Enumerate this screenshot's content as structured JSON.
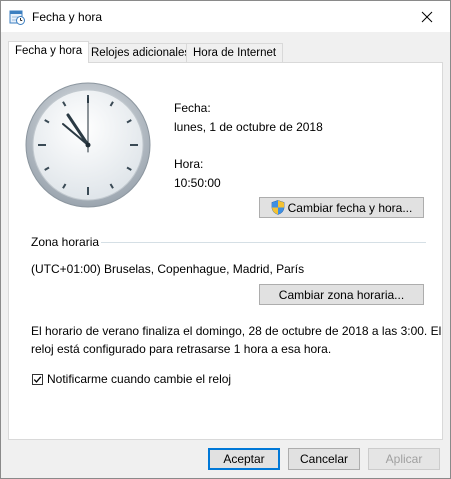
{
  "window": {
    "title": "Fecha y hora",
    "close_glyph": "✕"
  },
  "tabs": [
    {
      "label": "Fecha y hora",
      "active": true
    },
    {
      "label": "Relojes adicionales",
      "active": false
    },
    {
      "label": "Hora de Internet",
      "active": false
    }
  ],
  "datetime": {
    "date_label": "Fecha:",
    "date_value": "lunes, 1 de octubre de 2018",
    "time_label": "Hora:",
    "time_value": "10:50:00",
    "change_button": "Cambiar fecha y hora..."
  },
  "timezone": {
    "group_label": "Zona horaria",
    "value": "(UTC+01:00) Bruselas, Copenhague, Madrid, París",
    "change_button": "Cambiar zona horaria..."
  },
  "dst": {
    "notice_line1": "El horario de verano finaliza el domingo, 28 de octubre de 2018 a las 3:00. El",
    "notice_line2": "reloj está configurado para retrasarse 1 hora a esa hora.",
    "notify_label": "Notificarme cuando cambie el reloj",
    "notify_checked": true
  },
  "footer": {
    "ok": "Aceptar",
    "cancel": "Cancelar",
    "apply": "Aplicar"
  },
  "icons": {
    "window_icon": "calendar-clock-icon",
    "shield": "uac-shield-icon",
    "clock": "analog-clock-icon"
  },
  "colors": {
    "accent": "#0078d7",
    "panel": "#ffffff",
    "dialog_bg": "#f0f0f0"
  }
}
